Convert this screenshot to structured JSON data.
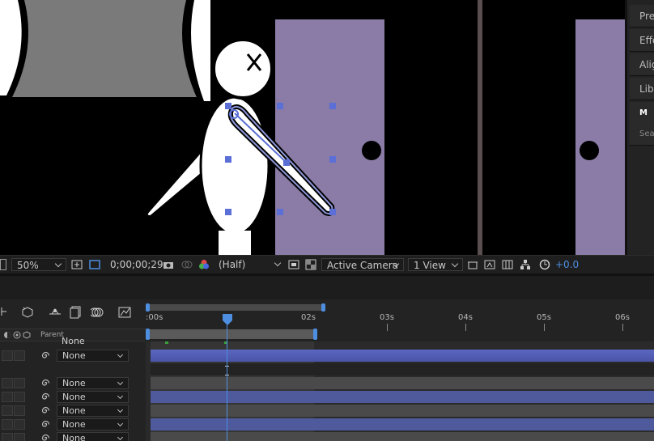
{
  "right_panel": {
    "items": [
      {
        "label": "Preview"
      },
      {
        "label": "Effects & Presets"
      },
      {
        "label": "Align"
      },
      {
        "label": "Libraries"
      },
      {
        "label": "M"
      },
      {
        "label": "Search"
      }
    ]
  },
  "viewer_toolbar": {
    "zoom": "50%",
    "timecode": "0;00;00;29",
    "resolution": "(Half)",
    "camera": "Active Camera",
    "view": "1 View",
    "exposure": "+0.0"
  },
  "timeline": {
    "column_header": "Parent",
    "ruler_labels": [
      ":00s",
      "02s",
      "03s",
      "04s",
      "05s",
      "06s"
    ],
    "layers": [
      {
        "parent": "None"
      },
      {
        "parent": "None"
      },
      {
        "parent": "None"
      },
      {
        "parent": "None"
      },
      {
        "parent": "None"
      },
      {
        "parent": "None"
      },
      {
        "parent": "None"
      }
    ]
  },
  "colors": {
    "door": "#8a7ca6",
    "accent": "#4e8ee0",
    "track_blue": "#4e5a9c",
    "handle": "#5b6fd6"
  }
}
